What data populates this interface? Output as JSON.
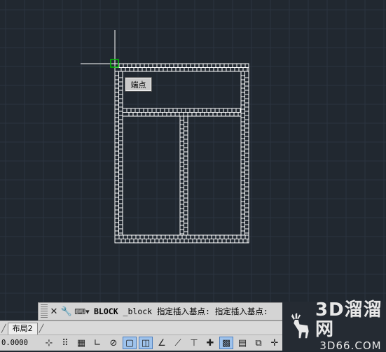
{
  "drawing": {
    "tooltip_label": "端点"
  },
  "command_line": {
    "close_icon": "close-icon",
    "settings_icon": "wrench-icon",
    "prompt_icon": "command-prompt-icon",
    "command_name": "BLOCK",
    "command_rest": " _block 指定插入基点: 指定插入基点:"
  },
  "layout_tabs": [
    {
      "label": "布局2"
    }
  ],
  "status_bar": {
    "coordinates": "0.0000",
    "buttons": [
      {
        "icon": "infer-constraints-icon",
        "on": false
      },
      {
        "icon": "snap-mode-icon",
        "on": false
      },
      {
        "icon": "grid-display-icon",
        "on": false
      },
      {
        "icon": "ortho-mode-icon",
        "on": false
      },
      {
        "icon": "polar-tracking-icon",
        "on": false
      },
      {
        "icon": "object-snap-icon",
        "on": true
      },
      {
        "icon": "3d-object-snap-icon",
        "on": true
      },
      {
        "icon": "object-snap-tracking-icon",
        "on": false
      },
      {
        "icon": "dynamic-ucs-icon",
        "on": false
      },
      {
        "icon": "dynamic-input-icon",
        "on": false
      },
      {
        "icon": "lineweight-icon",
        "on": false
      },
      {
        "icon": "transparency-icon",
        "on": true
      },
      {
        "icon": "quick-properties-icon",
        "on": false
      },
      {
        "icon": "selection-cycling-icon",
        "on": false
      },
      {
        "icon": "annotation-monitor-icon",
        "on": false
      }
    ]
  },
  "watermark": {
    "main": "3D溜溜网",
    "sub": "3D66.COM"
  },
  "colors": {
    "background": "#212830",
    "grid": "#2c3440",
    "wall": "#ffffff",
    "snap_marker": "#00c000"
  }
}
